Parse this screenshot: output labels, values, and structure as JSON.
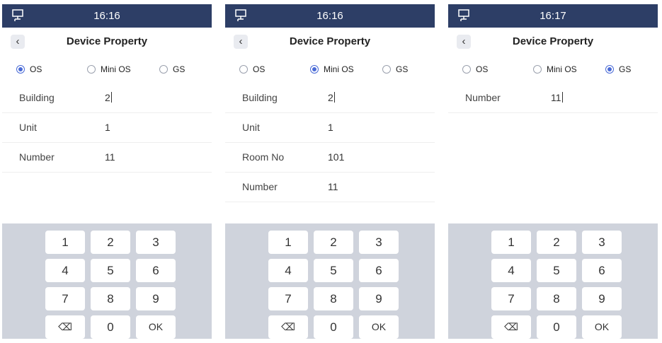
{
  "colors": {
    "header": "#2d3e66",
    "accent": "#4a6bd6",
    "keypad_bg": "#cfd3dc"
  },
  "screens": [
    {
      "time": "16:16",
      "title": "Device Property",
      "radios": [
        {
          "label": "OS",
          "selected": true
        },
        {
          "label": "Mini OS",
          "selected": false
        },
        {
          "label": "GS",
          "selected": false
        }
      ],
      "fields": [
        {
          "label": "Building",
          "value": "2"
        },
        {
          "label": "Unit",
          "value": "1"
        },
        {
          "label": "Number",
          "value": "11"
        }
      ],
      "keys": [
        "1",
        "2",
        "3",
        "4",
        "5",
        "6",
        "7",
        "8",
        "9",
        "⌫",
        "0",
        "OK"
      ]
    },
    {
      "time": "16:16",
      "title": "Device Property",
      "radios": [
        {
          "label": "OS",
          "selected": false
        },
        {
          "label": "Mini OS",
          "selected": true
        },
        {
          "label": "GS",
          "selected": false
        }
      ],
      "fields": [
        {
          "label": "Building",
          "value": "2"
        },
        {
          "label": "Unit",
          "value": "1"
        },
        {
          "label": "Room No",
          "value": "101"
        },
        {
          "label": "Number",
          "value": "11"
        }
      ],
      "keys": [
        "1",
        "2",
        "3",
        "4",
        "5",
        "6",
        "7",
        "8",
        "9",
        "⌫",
        "0",
        "OK"
      ]
    },
    {
      "time": "16:17",
      "title": "Device Property",
      "radios": [
        {
          "label": "OS",
          "selected": false
        },
        {
          "label": "Mini OS",
          "selected": false
        },
        {
          "label": "GS",
          "selected": true
        }
      ],
      "fields": [
        {
          "label": "Number",
          "value": "11"
        }
      ],
      "keys": [
        "1",
        "2",
        "3",
        "4",
        "5",
        "6",
        "7",
        "8",
        "9",
        "⌫",
        "0",
        "OK"
      ]
    }
  ]
}
